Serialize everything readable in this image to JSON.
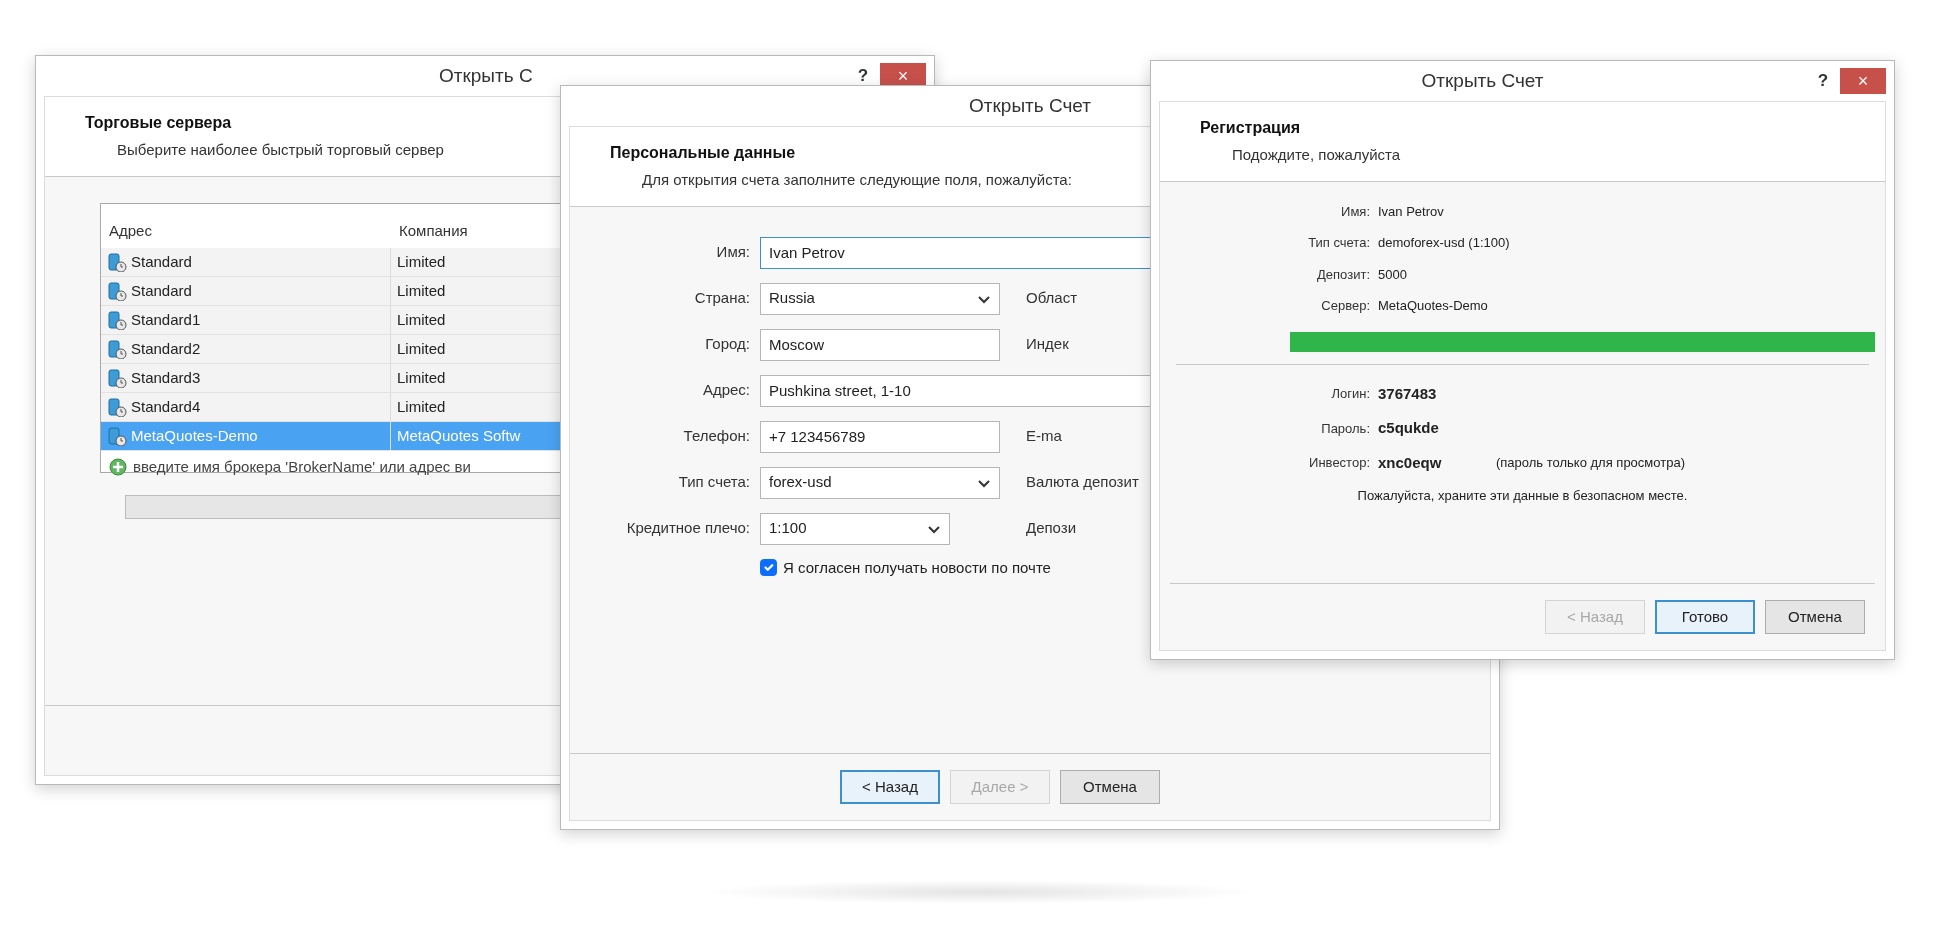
{
  "windows": [
    {
      "kind": "servers",
      "title": "Открыть С",
      "help": "?",
      "close": "×",
      "heading": "Торговые сервера",
      "subheading": "Выберите наиболее быстрый торговый сервер",
      "table": {
        "columns": [
          "Адрес",
          "Компания"
        ],
        "rows": [
          {
            "address": "Standard",
            "company": "Limited",
            "selected": false
          },
          {
            "address": "Standard",
            "company": "Limited",
            "selected": false
          },
          {
            "address": "Standard1",
            "company": "Limited",
            "selected": false
          },
          {
            "address": "Standard2",
            "company": "Limited",
            "selected": false
          },
          {
            "address": "Standard3",
            "company": "Limited",
            "selected": false
          },
          {
            "address": "Standard4",
            "company": "Limited",
            "selected": false
          },
          {
            "address": "MetaQuotes-Demo",
            "company": "MetaQuotes Softw",
            "selected": true
          }
        ]
      },
      "add_hint": "введите имя брокера 'BrokerName' или адрес ви"
    },
    {
      "kind": "personal",
      "title": "Открыть Счет",
      "heading": "Персональные данные",
      "subheading": "Для открытия счета заполните следующие поля, пожалуйста:",
      "fields": [
        {
          "label": "Имя:",
          "value": "Ivan Petrov",
          "kind": "longtext",
          "focused": true
        },
        {
          "label": "Страна:",
          "value": "Russia",
          "kind": "combo",
          "focused": false,
          "side_label": "Област"
        },
        {
          "label": "Город:",
          "value": "Moscow",
          "kind": "text",
          "focused": false,
          "side_label": "Индек"
        },
        {
          "label": "Адрес:",
          "value": "Pushkina street, 1-10",
          "kind": "longtext",
          "focused": false
        },
        {
          "label": "Телефон:",
          "value": "+7 123456789",
          "kind": "text",
          "focused": false,
          "side_label": "E-ma"
        },
        {
          "label": "Тип счета:",
          "value": "forex-usd",
          "kind": "combo",
          "focused": false,
          "side_label": "Валюта депозит"
        },
        {
          "label": "Кредитное плечо:",
          "value": "1:100",
          "kind": "shortcombo",
          "focused": false,
          "side_label": "Депози"
        }
      ],
      "checkbox": {
        "label": "Я согласен получать новости по почте",
        "checked": true
      },
      "buttons": [
        {
          "label": "< Назад",
          "focused": true,
          "disabled": false
        },
        {
          "label": "Далее >",
          "focused": false,
          "disabled": true
        },
        {
          "label": "Отмена",
          "focused": false,
          "disabled": false
        }
      ]
    },
    {
      "kind": "registration",
      "title": "Открыть Счет",
      "help": "?",
      "close": "×",
      "heading": "Регистрация",
      "subheading": "Подождите, пожалуйста",
      "details": [
        {
          "label": "Имя:",
          "value": "Ivan Petrov"
        },
        {
          "label": "Тип счета:",
          "value": "demoforex-usd (1:100)"
        },
        {
          "label": "Депозит:",
          "value": "5000"
        },
        {
          "label": "Сервер:",
          "value": "MetaQuotes-Demo"
        }
      ],
      "progress": {
        "level": 1.0
      },
      "credentials": [
        {
          "label": "Логин:",
          "value": "3767483"
        },
        {
          "label": "Пароль:",
          "value": "c5qukde"
        },
        {
          "label": "Инвестор:",
          "value": "xnc0eqw",
          "note": "(пароль только для просмотра)"
        }
      ],
      "message": "Пожалуйста, храните эти данные в безопасном месте.",
      "buttons": [
        {
          "label": "< Назад",
          "focused": false,
          "disabled": true
        },
        {
          "label": "Готово",
          "focused": true,
          "disabled": false
        },
        {
          "label": "Отмена",
          "focused": false,
          "disabled": false
        }
      ]
    }
  ]
}
